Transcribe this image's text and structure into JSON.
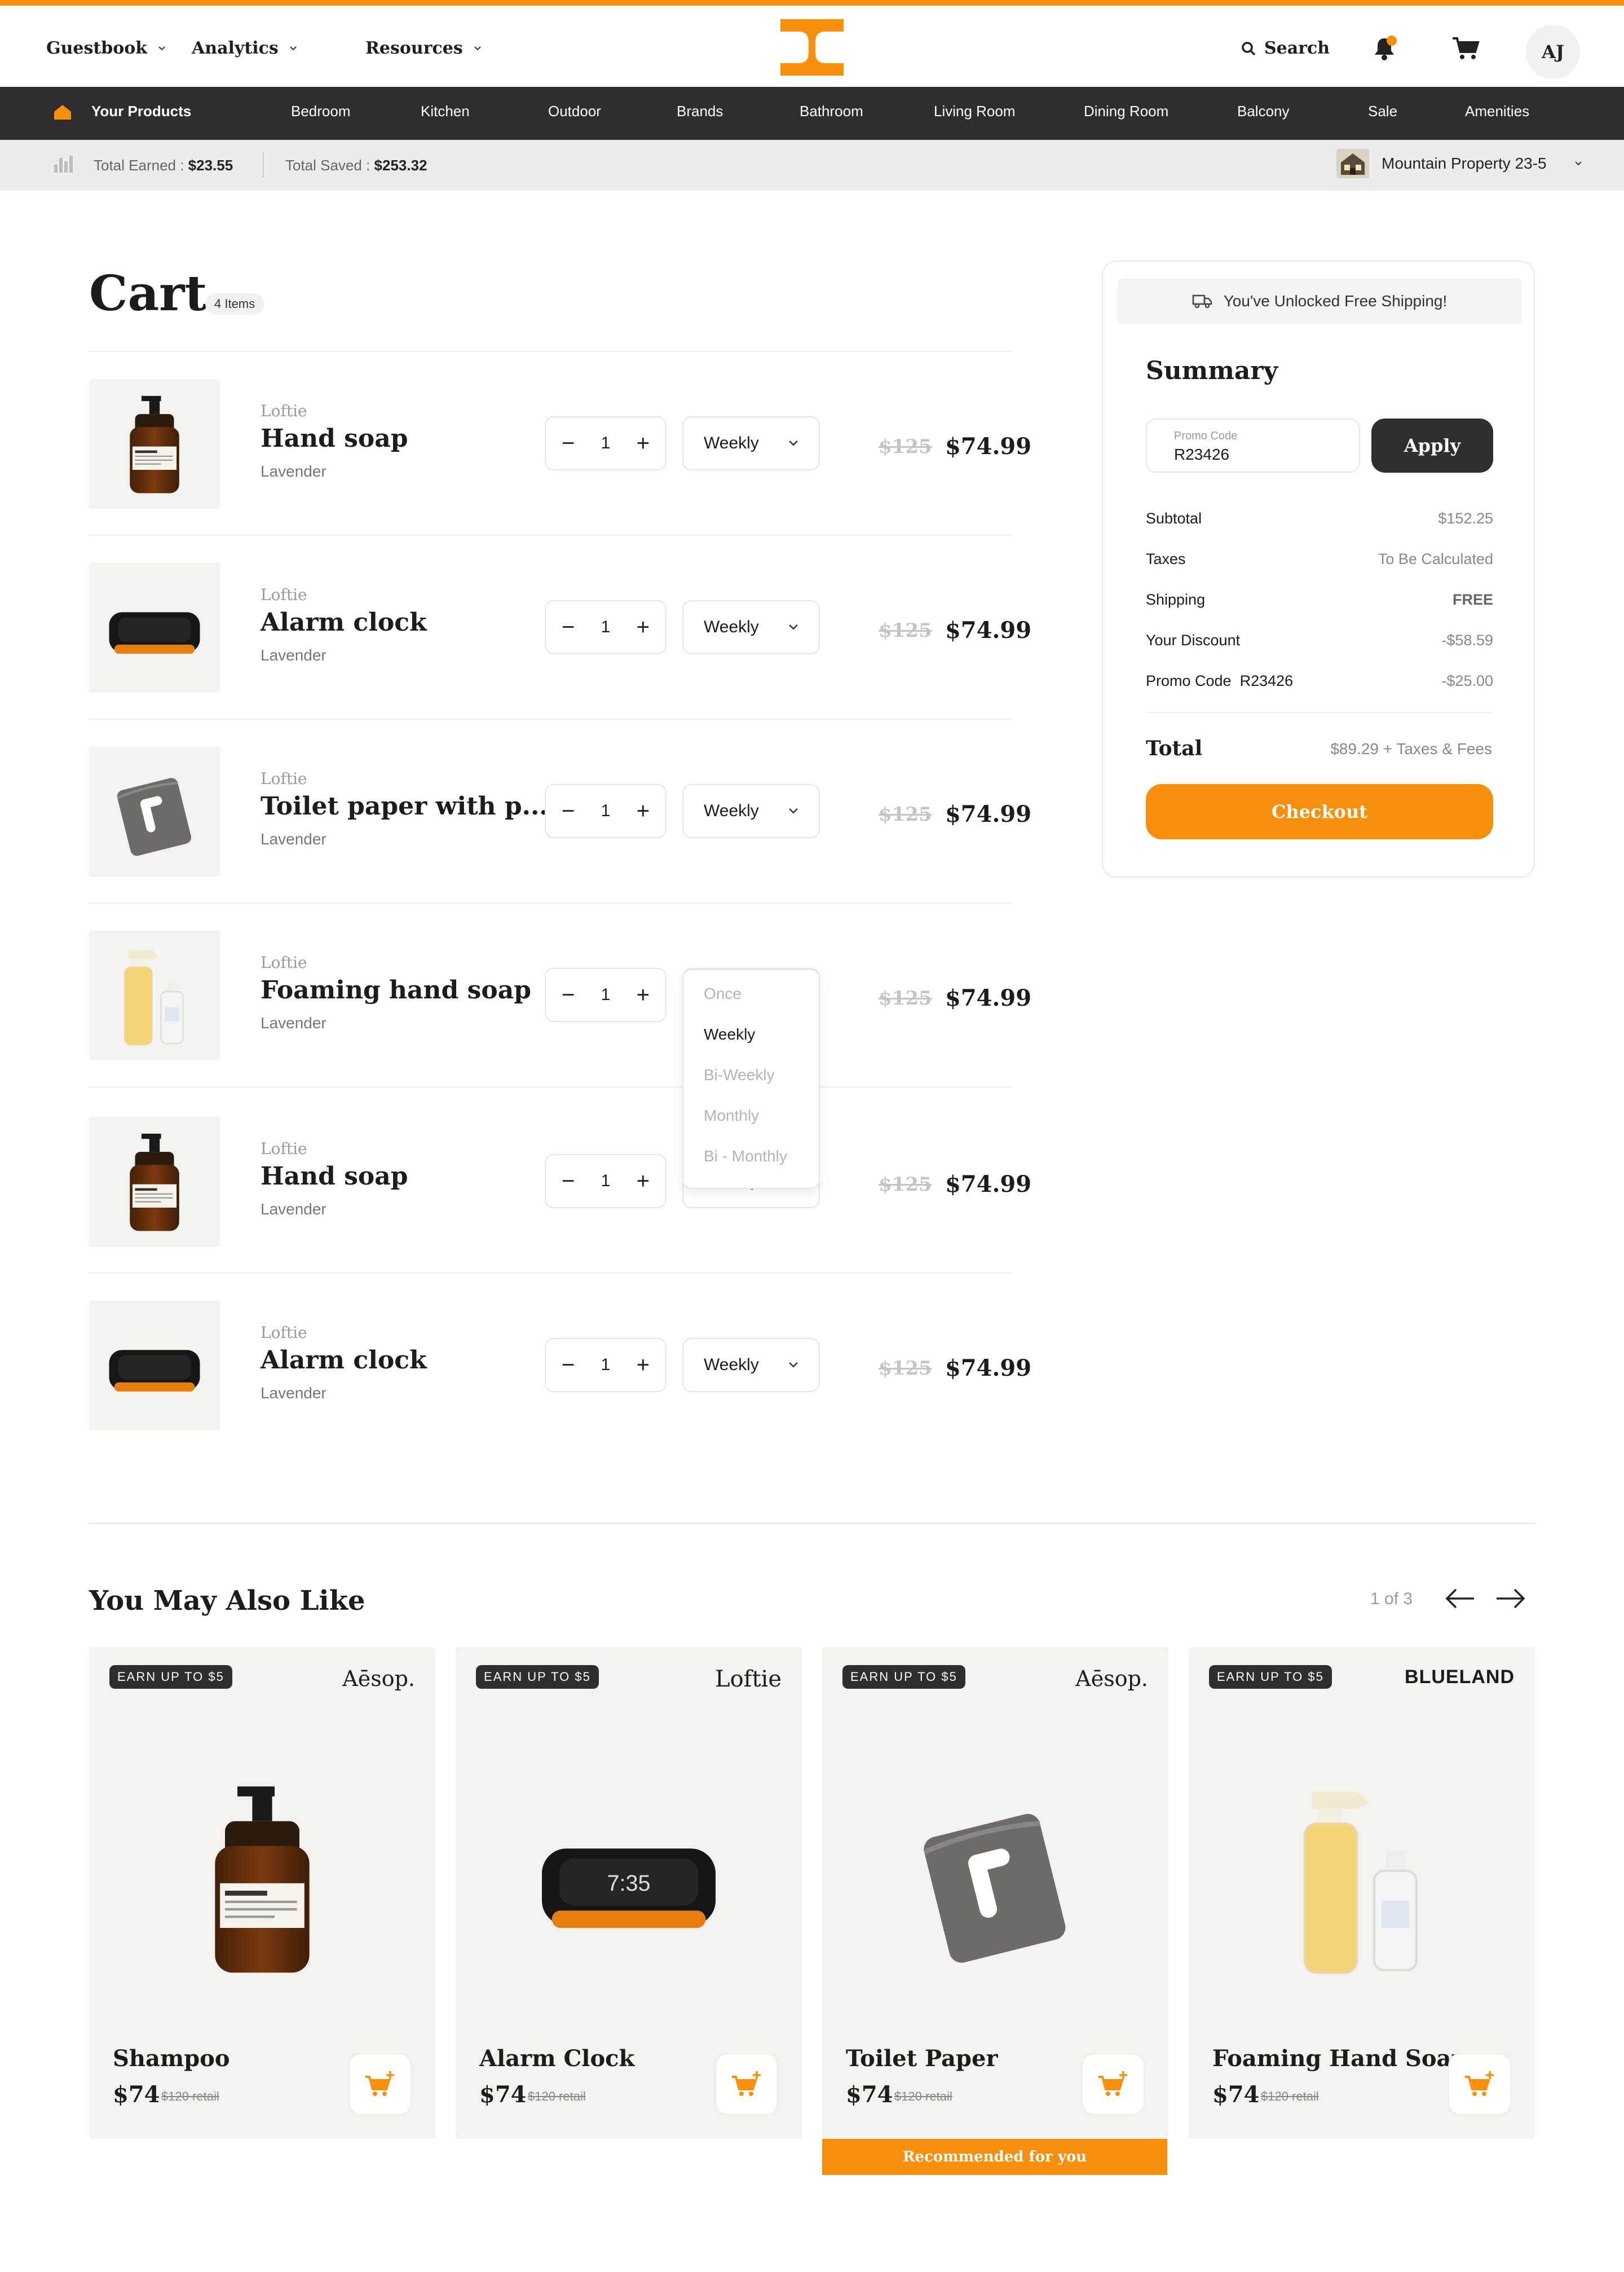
{
  "colors": {
    "accent": "#f78f0b",
    "dark": "#2e2e2e",
    "muted": "#9a9a9a"
  },
  "topnav": {
    "menus": [
      {
        "label": "Guestbook",
        "icon": "chevron-down-icon"
      },
      {
        "label": "Analytics",
        "icon": "chevron-down-icon"
      },
      {
        "label": "Resources",
        "icon": "chevron-down-icon"
      }
    ],
    "search_label": "Search",
    "notifications_count": "1",
    "avatar_initials": "AJ"
  },
  "categories": {
    "active": "Your Products",
    "items": [
      "Bedroom",
      "Kitchen",
      "Outdoor",
      "Brands",
      "Bathroom",
      "Living Room",
      "Dining Room",
      "Balcony",
      "Sale",
      "Amenities"
    ]
  },
  "stats": {
    "earned_label": "Total Earned : ",
    "earned_value": "$23.55",
    "saved_label": "Total Saved : ",
    "saved_value": "$253.32",
    "property": "Mountain Property 23-5"
  },
  "cart": {
    "title": "Cart",
    "count_label": "4 Items",
    "items": [
      {
        "brand": "Loftie",
        "name": "Hand soap",
        "variant": "Lavender",
        "qty": "1",
        "frequency": "Weekly",
        "old_price": "$125",
        "price": "$74.99",
        "image": "soap-bottle"
      },
      {
        "brand": "Loftie",
        "name": "Alarm clock",
        "variant": "Lavender",
        "qty": "1",
        "frequency": "Weekly",
        "old_price": "$125",
        "price": "$74.99",
        "image": "alarm-clock"
      },
      {
        "brand": "Loftie",
        "name": "Toilet paper with p...",
        "variant": "Lavender",
        "qty": "1",
        "frequency": "Weekly",
        "old_price": "$125",
        "price": "$74.99",
        "image": "toilet-paper"
      },
      {
        "brand": "Loftie",
        "name": "Foaming hand soap",
        "variant": "Lavender",
        "qty": "1",
        "frequency": "Weekly",
        "old_price": "$125",
        "price": "$74.99",
        "image": "foam-bottles"
      },
      {
        "brand": "Loftie",
        "name": "Hand soap",
        "variant": "Lavender",
        "qty": "1",
        "frequency": "Weekly",
        "old_price": "$125",
        "price": "$74.99",
        "image": "soap-bottle"
      },
      {
        "brand": "Loftie",
        "name": "Alarm clock",
        "variant": "Lavender",
        "qty": "1",
        "frequency": "Weekly",
        "old_price": "$125",
        "price": "$74.99",
        "image": "alarm-clock"
      }
    ],
    "frequency_options": [
      "Once",
      "Weekly",
      "Bi-Weekly",
      "Monthly",
      "Bi - Monthly"
    ],
    "frequency_selected": "Weekly"
  },
  "summary": {
    "shipping_banner": "You've Unlocked Free Shipping!",
    "title": "Summary",
    "promo_label": "Promo Code",
    "promo_value": "R23426",
    "apply_label": "Apply",
    "rows": [
      {
        "label": "Subtotal",
        "value": "$152.25"
      },
      {
        "label": "Taxes",
        "value": "To Be Calculated"
      },
      {
        "label": "Shipping",
        "value": "FREE"
      },
      {
        "label": "Your Discount",
        "value": "-$58.59"
      },
      {
        "label": "Promo Code  R23426",
        "value": "-$25.00"
      }
    ],
    "total_label": "Total",
    "total_value": "$89.29 + Taxes & Fees",
    "checkout_label": "Checkout"
  },
  "recommendations": {
    "title": "You May Also Like",
    "pager": "1 of 3",
    "cards": [
      {
        "badge": "EARN UP TO $5",
        "brand": "Aēsop.",
        "name": "Shampoo",
        "price": "$74",
        "retail": "$120 retail",
        "image": "soap-bottle"
      },
      {
        "badge": "EARN UP TO $5",
        "brand": "Loftie",
        "name": "Alarm Clock",
        "price": "$74",
        "retail": "$120 retail",
        "image": "alarm-clock",
        "clock_text": "7:35"
      },
      {
        "badge": "EARN UP TO $5",
        "brand": "Aēsop.",
        "name": "Toilet Paper",
        "price": "$74",
        "retail": "$120 retail",
        "image": "toilet-paper"
      },
      {
        "badge": "EARN UP TO $5",
        "brand": "BLUELAND",
        "name": "Foaming Hand Soap",
        "price": "$74",
        "retail": "$120 retail",
        "image": "foam-bottles"
      }
    ],
    "recommended_banner": "Recommended for you"
  }
}
